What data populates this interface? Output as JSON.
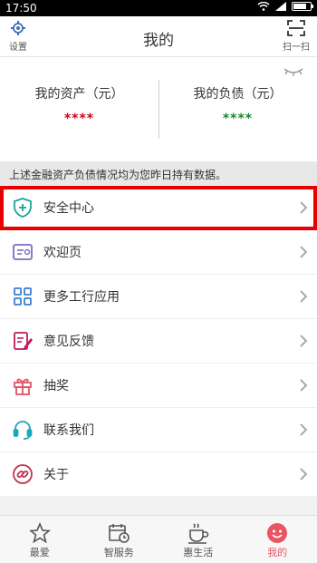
{
  "status": {
    "time": "17:50"
  },
  "header": {
    "title": "我的",
    "settings_label": "设置",
    "scan_label": "扫一扫"
  },
  "assets": {
    "assets_label": "我的资产（元）",
    "assets_value": "****",
    "liabilities_label": "我的负债（元）",
    "liabilities_value": "****"
  },
  "notice": "上述金融资产负债情况均为您昨日持有数据。",
  "menu": [
    {
      "label": "安全中心",
      "icon": "shield-plus-icon"
    },
    {
      "label": "欢迎页",
      "icon": "welcome-card-icon"
    },
    {
      "label": "更多工行应用",
      "icon": "apps-grid-icon"
    },
    {
      "label": "意见反馈",
      "icon": "feedback-icon"
    },
    {
      "label": "抽奖",
      "icon": "gift-icon"
    },
    {
      "label": "联系我们",
      "icon": "headset-icon"
    },
    {
      "label": "关于",
      "icon": "link-icon"
    }
  ],
  "tabs": [
    {
      "label": "最爱",
      "icon": "star-icon"
    },
    {
      "label": "智服务",
      "icon": "calendar-clock-icon"
    },
    {
      "label": "惠生活",
      "icon": "coffee-icon"
    },
    {
      "label": "我的",
      "icon": "smile-icon"
    }
  ],
  "colors": {
    "assets_value": "#d0021b",
    "liabilities_value": "#1a8a2e",
    "highlight": "#e60000",
    "active_tab": "#e8565f"
  }
}
